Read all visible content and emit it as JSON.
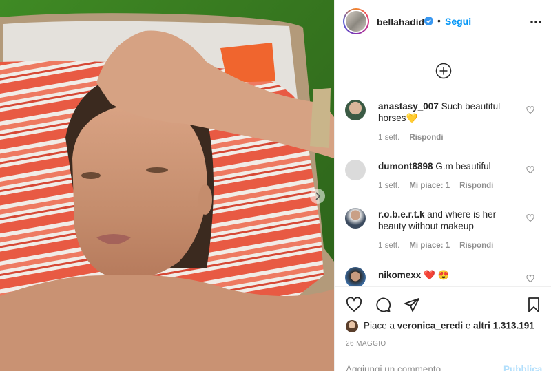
{
  "post": {
    "author": "bellahadid",
    "separator": "•",
    "follow_label": "Segui",
    "verified": true,
    "accent_color": "#0095f6",
    "verified_color": "#3897f0"
  },
  "icons": {
    "more": "more-options-icon",
    "load_more": "plus-circle-icon",
    "like": "heart-icon",
    "comment": "comment-icon",
    "share": "paper-plane-icon",
    "save": "bookmark-icon",
    "next": "chevron-right-icon"
  },
  "comments": [
    {
      "user": "anastasy_007",
      "text": "Such beautiful horses",
      "emoji": "💛",
      "time": "1 sett.",
      "likes": "",
      "reply": "Rispondi"
    },
    {
      "user": "dumont8898",
      "text": "G.m beautiful",
      "emoji": "",
      "time": "1 sett.",
      "likes": "Mi piace: 1",
      "reply": "Rispondi"
    },
    {
      "user": "r.o.b.e.r.t.k",
      "text": "and where is her beauty without makeup",
      "emoji": "",
      "time": "1 sett.",
      "likes": "Mi piace: 1",
      "reply": "Rispondi"
    },
    {
      "user": "nikomexx",
      "text": "",
      "emoji": "❤️ 😍",
      "time": "",
      "likes": "",
      "reply": ""
    }
  ],
  "likes": {
    "prefix": "Piace a",
    "user": "veronica_eredi",
    "joiner": "e",
    "others": "altri 1.313.191"
  },
  "date": "26 MAGGIO",
  "comment_box": {
    "placeholder": "Aggiungi un commento...",
    "publish_label": "Pubblica"
  }
}
